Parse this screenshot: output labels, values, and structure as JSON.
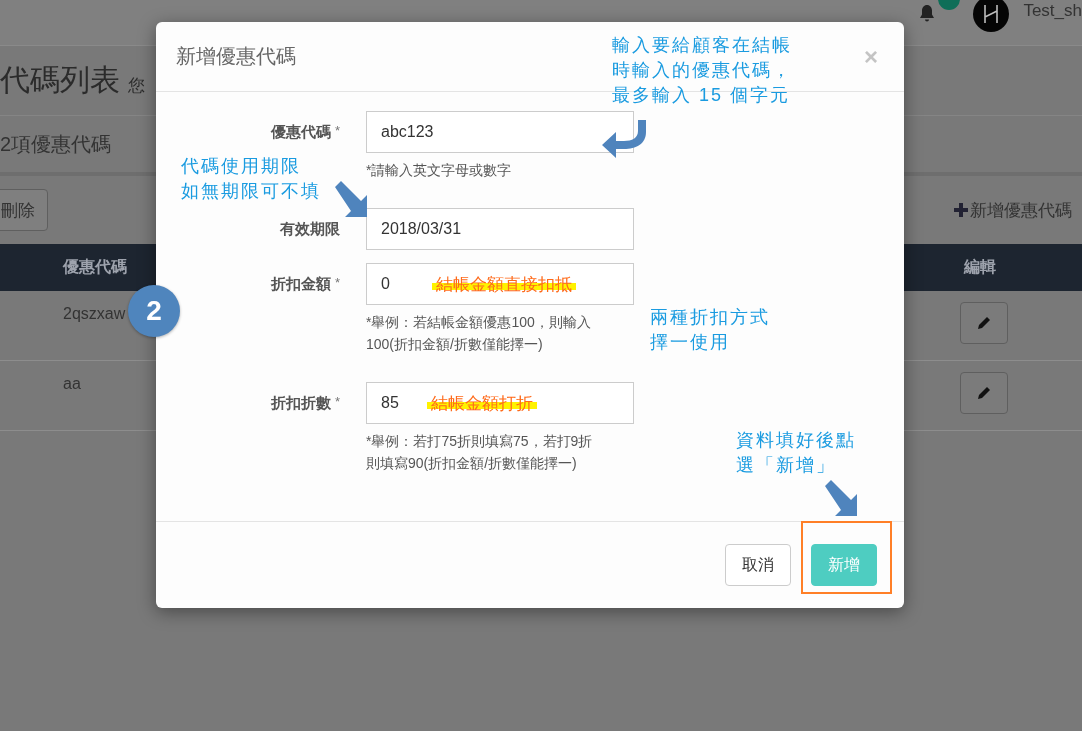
{
  "top_bar": {
    "user_name": "Test_sh"
  },
  "page": {
    "title": "代碼列表",
    "title_note": "您",
    "count_text": "2項優惠代碼",
    "delete_button": "刪除",
    "add_link": "新增優惠代碼",
    "table": {
      "columns": [
        "優惠代碼",
        "編輯"
      ],
      "rows": [
        {
          "code": "2qszxaw"
        },
        {
          "code": "aa"
        }
      ]
    }
  },
  "modal": {
    "title": "新增優惠代碼",
    "close": "×",
    "fields": [
      {
        "label": "優惠代碼",
        "required_mark": "*",
        "value": "abc123",
        "hint_lines": [
          "*請輸入英文字母或數字"
        ]
      },
      {
        "label": "有效期限",
        "value": "2018/03/31"
      },
      {
        "label": "折扣金額",
        "required_mark": "*",
        "value": "0",
        "highlight": "結帳金額直接扣抵",
        "hint_lines": [
          "*舉例：若結帳金額優惠100，則輸入",
          "100(折扣金額/折數僅能擇一)"
        ]
      },
      {
        "label": "折扣折數",
        "required_mark": "*",
        "value": "85",
        "highlight": "結帳金額打折",
        "hint_lines": [
          "*舉例：若打75折則填寫75，若打9折",
          "則填寫90(折扣金額/折數僅能擇一)"
        ]
      }
    ],
    "buttons": [
      {
        "label": "取消",
        "kind": "default"
      },
      {
        "label": "新增",
        "kind": "primary"
      }
    ]
  },
  "annotations": {
    "step": "2",
    "notes": [
      {
        "kind": "code",
        "lines": [
          "輸入要給顧客在結帳",
          "時輸入的優惠代碼，",
          "最多輸入 15 個字元"
        ]
      },
      {
        "kind": "expiry",
        "lines": [
          "代碼使用期限",
          "如無期限可不填"
        ]
      },
      {
        "kind": "discount",
        "lines": [
          "兩種折扣方式",
          "擇一使用"
        ]
      },
      {
        "kind": "submit",
        "lines": [
          "資料填好後點",
          "選「新增」"
        ]
      }
    ]
  }
}
